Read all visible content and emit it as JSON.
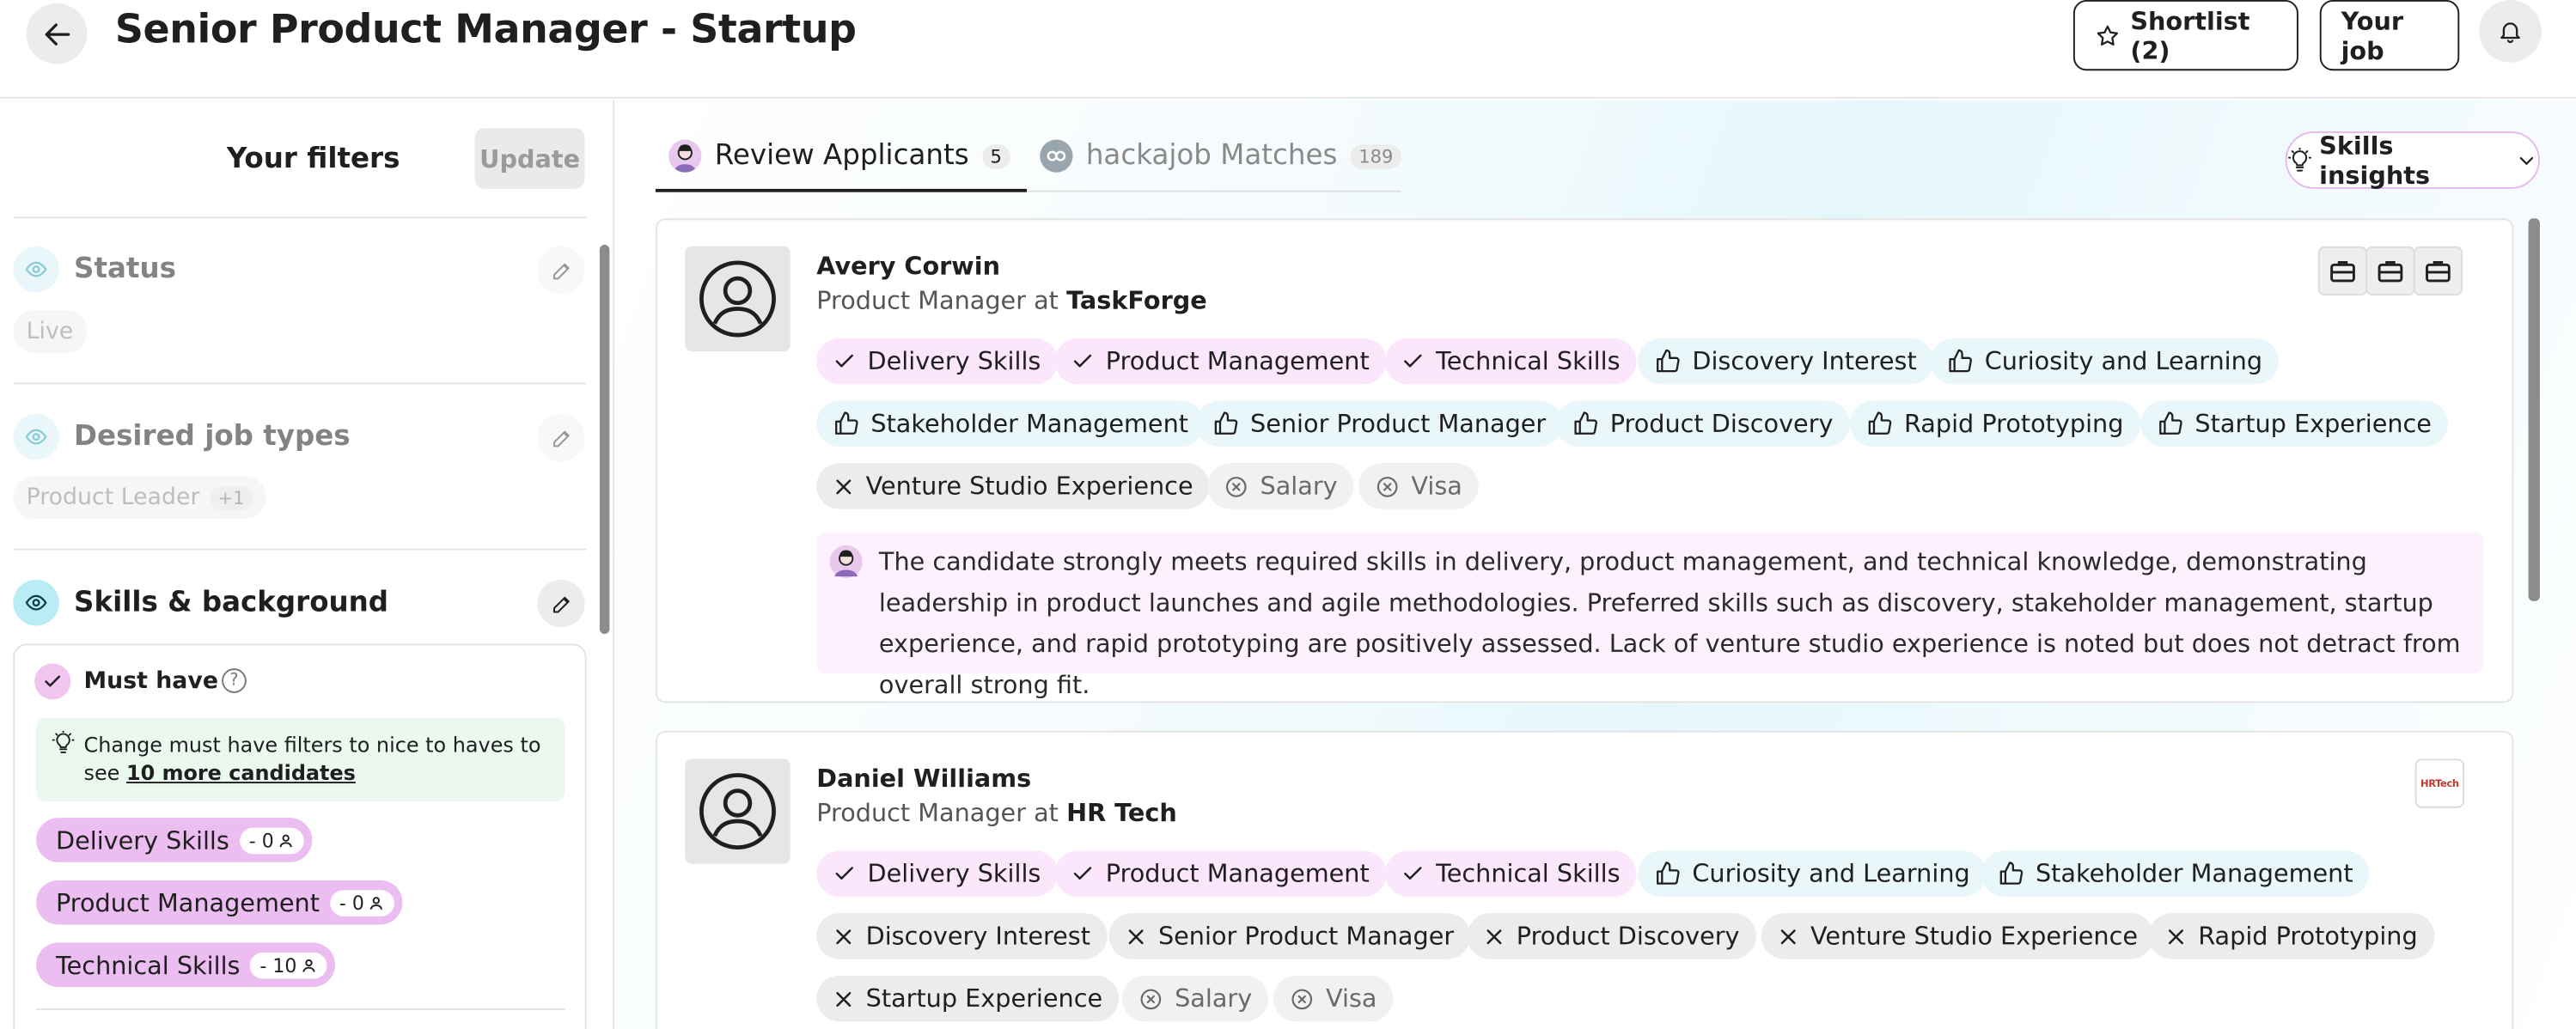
{
  "header": {
    "title": "Senior Product Manager - Startup",
    "shortlist_label": "Shortlist (2)",
    "your_job_label": "Your job"
  },
  "sidebar": {
    "title": "Your filters",
    "update_label": "Update",
    "status": {
      "title": "Status",
      "value": "Live"
    },
    "job_types": {
      "title": "Desired job types",
      "value": "Product Leader",
      "more": "+1"
    },
    "skills": {
      "title": "Skills & background",
      "must_have_label": "Must have",
      "help": "?",
      "tip_text": "Change must have filters to nice to haves to see ",
      "tip_link": "10 more candidates",
      "chips": [
        {
          "label": "Delivery Skills",
          "count": "- 0"
        },
        {
          "label": "Product Management",
          "count": "- 0"
        },
        {
          "label": "Technical Skills",
          "count": "- 10"
        }
      ]
    }
  },
  "tabs": [
    {
      "label": "Review Applicants",
      "count": "5"
    },
    {
      "label": "hackajob Matches",
      "count": "189"
    }
  ],
  "insights_label": "Skills insights",
  "candidates": [
    {
      "name": "Avery Corwin",
      "role_prefix": "Product Manager at ",
      "company": "TaskForge",
      "tags": [
        {
          "label": "Delivery Skills",
          "kind": "met"
        },
        {
          "label": "Product Management",
          "kind": "met"
        },
        {
          "label": "Technical Skills",
          "kind": "met"
        },
        {
          "label": "Discovery Interest",
          "kind": "pref"
        },
        {
          "label": "Curiosity and Learning",
          "kind": "pref"
        },
        {
          "label": "Stakeholder Management",
          "kind": "pref"
        },
        {
          "label": "Senior Product Manager",
          "kind": "pref"
        },
        {
          "label": "Product Discovery",
          "kind": "pref"
        },
        {
          "label": "Rapid Prototyping",
          "kind": "pref"
        },
        {
          "label": "Startup Experience",
          "kind": "pref"
        },
        {
          "label": "Venture Studio Experience",
          "kind": "miss"
        },
        {
          "label": "Salary",
          "kind": "unk"
        },
        {
          "label": "Visa",
          "kind": "unk"
        }
      ],
      "summary": "The candidate strongly meets required skills in delivery, product management, and technical knowledge, demonstrating leadership in product launches and agile methodologies. Preferred skills such as discovery, stakeholder management, startup experience, and rapid prototyping are positively assessed. Lack of venture studio experience is noted but does not detract from overall strong fit."
    },
    {
      "name": "Daniel Williams",
      "role_prefix": "Product Manager at ",
      "company": "HR Tech",
      "logo_text": "HRTech",
      "tags": [
        {
          "label": "Delivery Skills",
          "kind": "met"
        },
        {
          "label": "Product Management",
          "kind": "met"
        },
        {
          "label": "Technical Skills",
          "kind": "met"
        },
        {
          "label": "Curiosity and Learning",
          "kind": "pref"
        },
        {
          "label": "Stakeholder Management",
          "kind": "pref"
        },
        {
          "label": "Discovery Interest",
          "kind": "miss"
        },
        {
          "label": "Senior Product Manager",
          "kind": "miss"
        },
        {
          "label": "Product Discovery",
          "kind": "miss"
        },
        {
          "label": "Venture Studio Experience",
          "kind": "miss"
        },
        {
          "label": "Rapid Prototyping",
          "kind": "miss"
        },
        {
          "label": "Startup Experience",
          "kind": "miss"
        },
        {
          "label": "Salary",
          "kind": "unk"
        },
        {
          "label": "Visa",
          "kind": "unk"
        }
      ]
    }
  ]
}
